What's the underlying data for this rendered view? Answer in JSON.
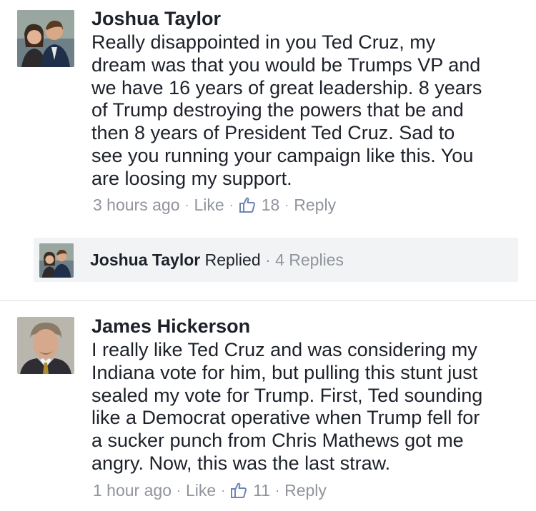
{
  "comments": [
    {
      "author": "Joshua Taylor",
      "avatar_icon": "couple-photo-icon",
      "text": "Really disappointed in you Ted Cruz, my\ndream was that you would be Trumps VP and\nwe have 16 years of great leadership. 8 years\nof Trump destroying the powers that be and\nthen 8 years of President Ted Cruz. Sad to\nsee you running your campaign like this. You\nare loosing my support.",
      "time": "3 hours ago",
      "like_label": "Like",
      "like_count": "18",
      "reply_label": "Reply"
    },
    {
      "author": "James Hickerson",
      "avatar_icon": "man-portrait-icon",
      "text": "I really like Ted Cruz and was considering my\nIndiana vote for him, but pulling this stunt just\nsealed my vote for Trump.  First, Ted sounding\nlike a Democrat operative when Trump fell for\na sucker punch from Chris Mathews got me\nangry.  Now, this was the last straw.",
      "time": "1 hour ago",
      "like_label": "Like",
      "like_count": "11",
      "reply_label": "Reply"
    }
  ],
  "replies_bar": {
    "author": "Joshua Taylor",
    "action": "Replied",
    "count_label": "4 Replies"
  },
  "separator": "·",
  "colors": {
    "text": "#1d2129",
    "meta": "#90949c",
    "reply_bar_bg": "#f2f3f5",
    "divider": "#dddfe2"
  }
}
